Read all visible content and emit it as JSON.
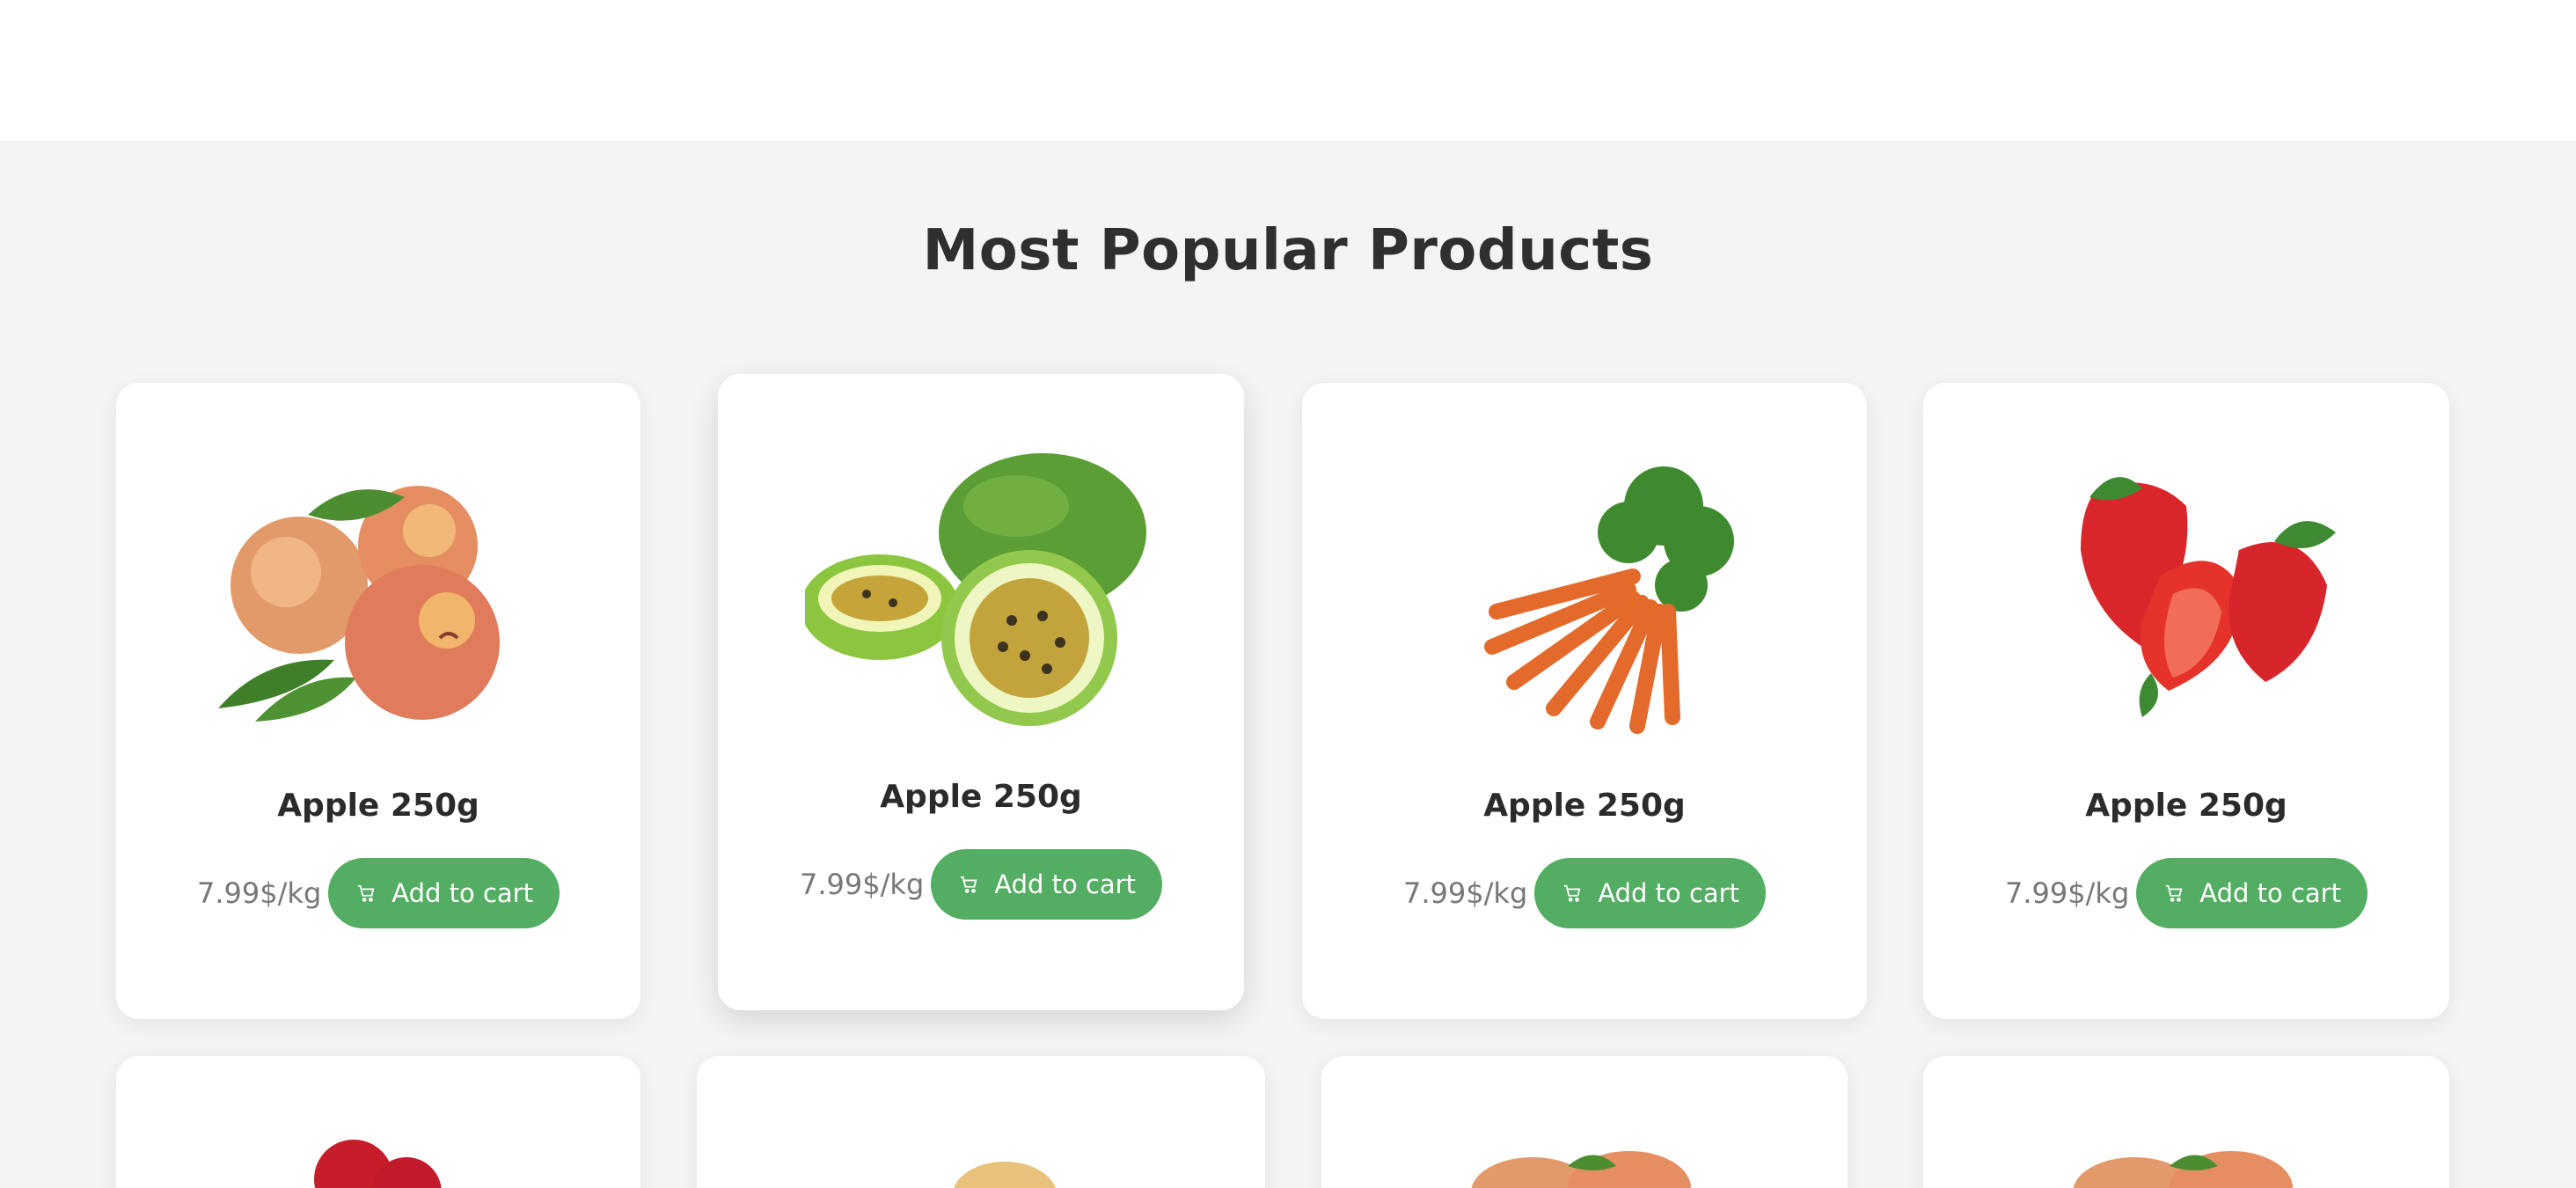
{
  "section": {
    "title": "Most Popular Products"
  },
  "products": [
    {
      "name": "Apple 250g",
      "price": "7.99$/kg",
      "button": "Add to cart",
      "image": "peach-image"
    },
    {
      "name": "Apple 250g",
      "price": "7.99$/kg",
      "button": "Add to cart",
      "image": "passion-fruit-image"
    },
    {
      "name": "Apple 250g",
      "price": "7.99$/kg",
      "button": "Add to cart",
      "image": "carrot-image"
    },
    {
      "name": "Apple 250g",
      "price": "7.99$/kg",
      "button": "Add to cart",
      "image": "strawberry-image"
    }
  ],
  "colors": {
    "accent": "#53ad62",
    "background": "#f4f4f4",
    "card": "#ffffff"
  },
  "icons": {
    "cart": "cart-icon"
  }
}
